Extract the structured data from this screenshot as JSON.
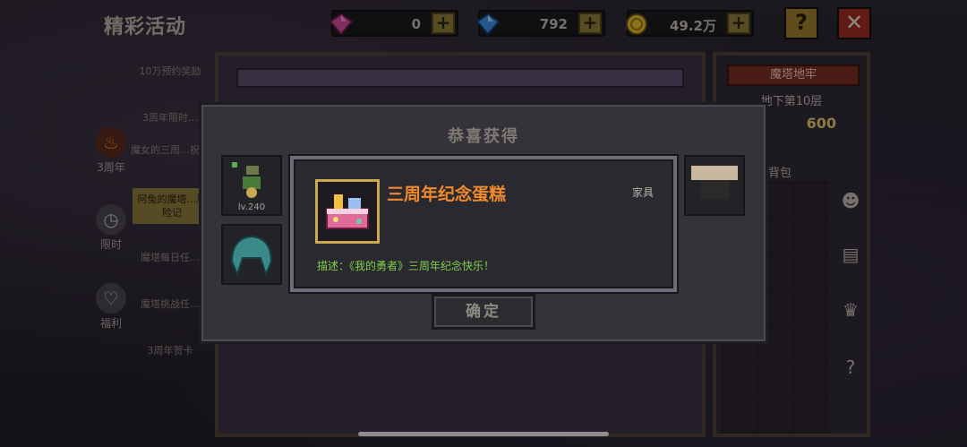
{
  "header": {
    "title": "精彩活动",
    "currencies": [
      {
        "icon": "pink-gem-icon",
        "amount": "0",
        "color": "#d04a9a"
      },
      {
        "icon": "blue-gem-icon",
        "amount": "792",
        "color": "#3a8ee0"
      },
      {
        "icon": "gold-coin-icon",
        "amount": "49.2万",
        "color": "#e0b830"
      }
    ],
    "plus_symbol": "+",
    "help_symbol": "?",
    "close_symbol": "✕"
  },
  "sidebar": {
    "categories": [
      {
        "label": "3周年",
        "icon": "flame-icon"
      },
      {
        "label": "限时",
        "icon": "clock-icon"
      },
      {
        "label": "福利",
        "icon": "heart-icon"
      }
    ],
    "items": [
      {
        "label": "10万预约奖励"
      },
      {
        "label": "3周年限时…"
      },
      {
        "label": "魔女的三周…祝福"
      },
      {
        "label": "阿兔的魔塔…历险记"
      },
      {
        "label": "魔塔每日任…"
      },
      {
        "label": "魔塔挑战任…"
      },
      {
        "label": "3周年贺卡"
      }
    ]
  },
  "right_panel": {
    "title": "魔塔地牢",
    "floor": "地下第10层",
    "score": "600",
    "bag_label": "背包"
  },
  "modal": {
    "title": "恭喜获得",
    "left_slot_level": "lv.240",
    "item": {
      "name": "三周年纪念蛋糕",
      "type": "家具",
      "description": "描述：《我的勇者》三周年纪念快乐！"
    },
    "confirm_label": "确定"
  },
  "colors": {
    "accent_gold": "#c9a84f",
    "item_name": "#f08a2c",
    "description": "#7fd04a",
    "close_red": "#9b2c22"
  }
}
